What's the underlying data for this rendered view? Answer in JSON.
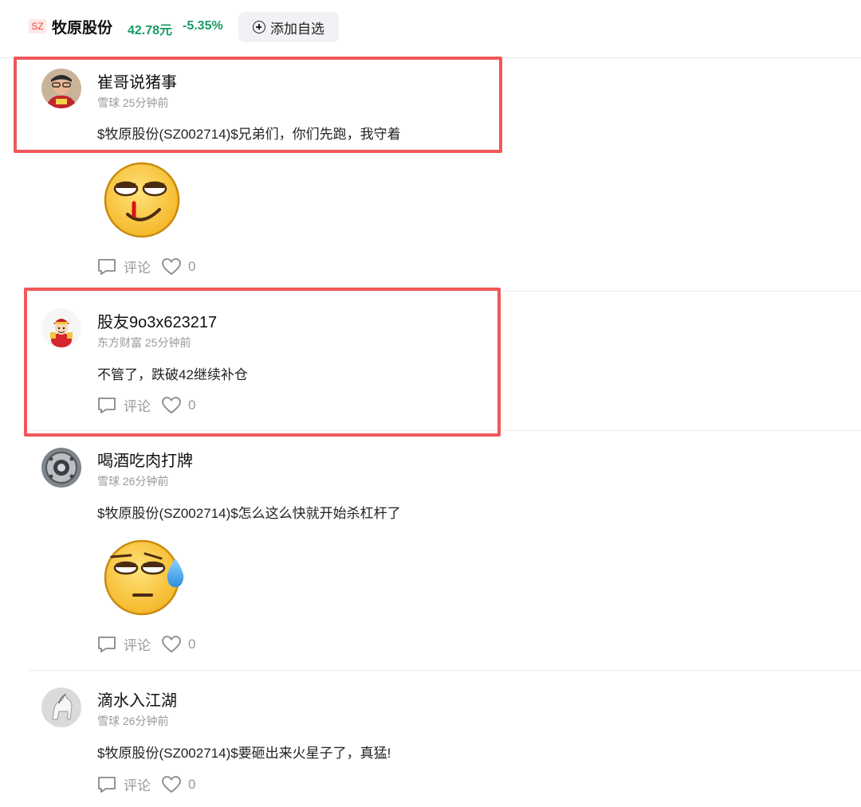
{
  "header": {
    "exchange": "SZ",
    "stock_name": "牧原股份",
    "price": "42.78元",
    "change_pct": "-5.35%",
    "add_watchlist": "添加自选",
    "price_color": "#1a9b63"
  },
  "actions": {
    "comment_label": "评论"
  },
  "posts": [
    {
      "username": "崔哥说猪事",
      "source": "雪球",
      "time": "25分钟前",
      "content": "$牧原股份(SZ002714)$兄弟们，你们先跑，我守着",
      "emoji": "smirk-nosebleed-emoji",
      "likes": "0"
    },
    {
      "username": "股友9o3x623217",
      "source": "东方财富",
      "time": "25分钟前",
      "content": "不管了，跌破42继续补仓",
      "likes": "0"
    },
    {
      "username": "喝酒吃肉打牌",
      "source": "雪球",
      "time": "26分钟前",
      "content": "$牧原股份(SZ002714)$怎么这么快就开始杀杠杆了",
      "emoji": "sweat-emoji",
      "likes": "0"
    },
    {
      "username": "滴水入江湖",
      "source": "雪球",
      "time": "26分钟前",
      "content": "$牧原股份(SZ002714)$要砸出来火星子了，真猛!",
      "likes": "0"
    }
  ],
  "highlight_color": "#f0585a"
}
